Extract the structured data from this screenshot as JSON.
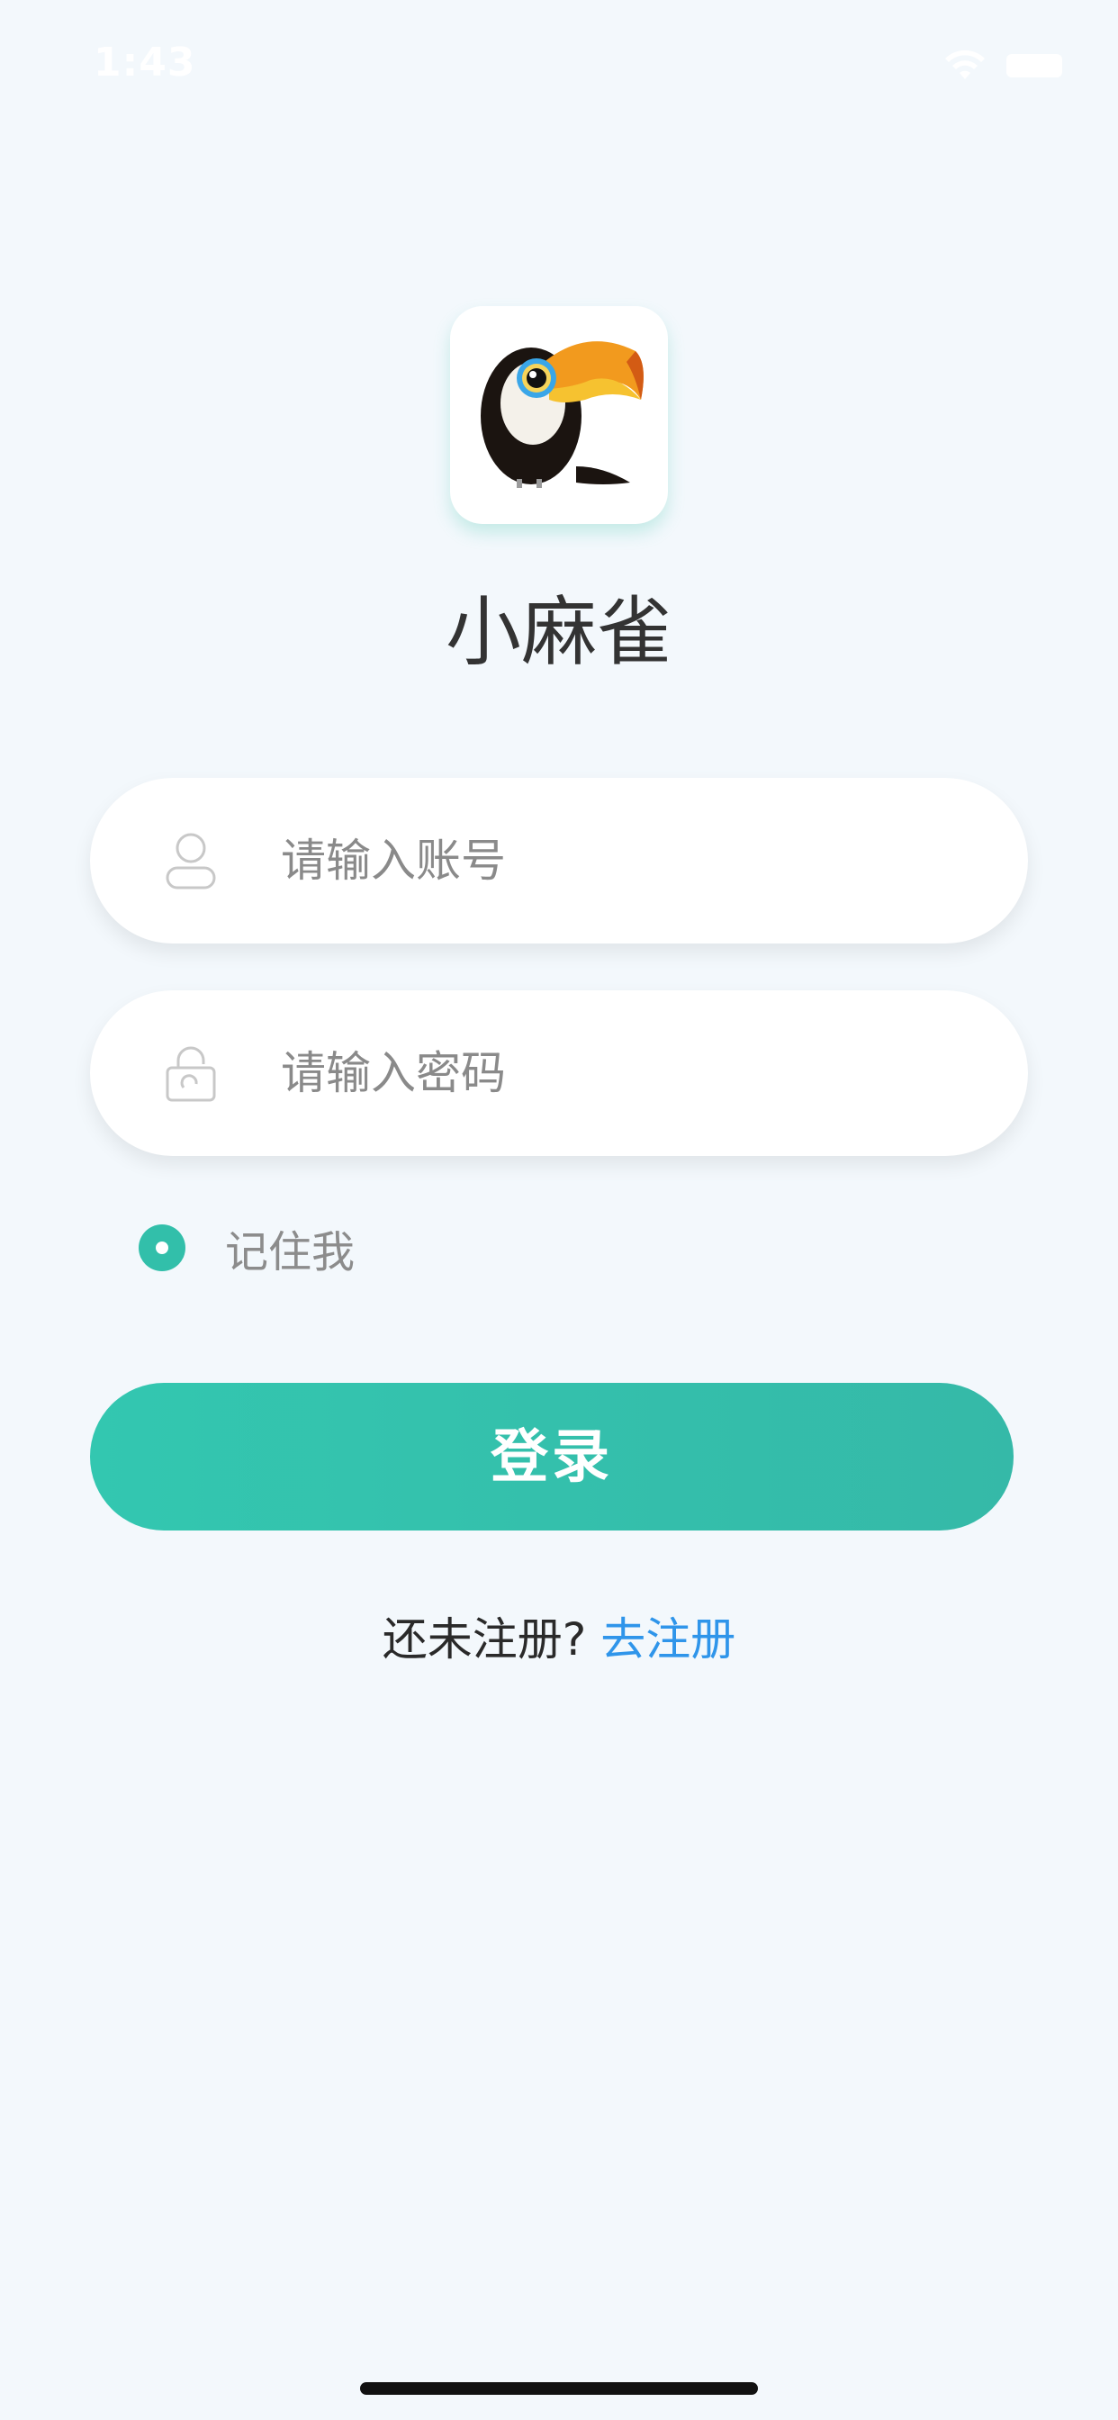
{
  "status_bar": {
    "time": "1:43",
    "wifi_icon": "wifi-icon",
    "battery_icon": "battery-icon"
  },
  "app": {
    "logo_icon": "toucan-logo-icon",
    "title": "小麻雀"
  },
  "form": {
    "account": {
      "icon": "user-icon",
      "placeholder": "请输入账号",
      "value": ""
    },
    "password": {
      "icon": "lock-icon",
      "placeholder": "请输入密码",
      "value": ""
    },
    "remember_me": {
      "label": "记住我",
      "checked": true
    },
    "login_button": "登录"
  },
  "register": {
    "question": "还未注册?",
    "link": "去注册"
  },
  "colors": {
    "background": "#f3f8fc",
    "accent": "#32bfaa",
    "link": "#2f95ea"
  }
}
